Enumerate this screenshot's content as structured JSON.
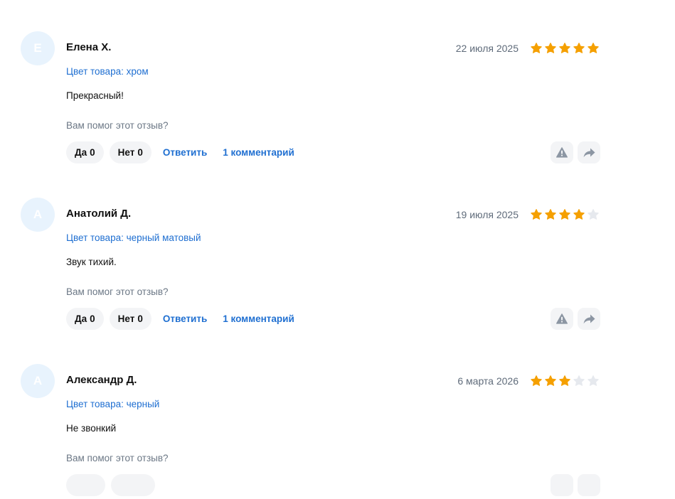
{
  "reviews": [
    {
      "avatar_letter": "Е",
      "author": "Елена Х.",
      "date": "22 июля 2025",
      "rating": 5,
      "variant": "Цвет товара: хром",
      "text": "Прекрасный!",
      "helpful_question": "Вам помог этот отзыв?",
      "yes_label": "Да",
      "yes_count": "0",
      "no_label": "Нет",
      "no_count": "0",
      "reply_label": "Ответить",
      "comments_label": "1 комментарий"
    },
    {
      "avatar_letter": "А",
      "author": "Анатолий Д.",
      "date": "19 июля 2025",
      "rating": 4,
      "variant": "Цвет товара: черный матовый",
      "text": "Звук тихий.",
      "helpful_question": "Вам помог этот отзыв?",
      "yes_label": "Да",
      "yes_count": "0",
      "no_label": "Нет",
      "no_count": "0",
      "reply_label": "Ответить",
      "comments_label": "1 комментарий"
    },
    {
      "avatar_letter": "А",
      "author": "Александр Д.",
      "date": "6 марта 2026",
      "rating": 3,
      "variant": "Цвет товара: черный",
      "text": "Не звонкий",
      "helpful_question": "Вам помог этот отзыв?",
      "yes_label": "",
      "yes_count": "",
      "no_label": "",
      "no_count": "",
      "reply_label": "",
      "comments_label": ""
    }
  ],
  "colors": {
    "star_filled": "#f5a000",
    "star_empty": "#e6e9ee",
    "link": "#1f6fd1",
    "avatar_bg": "#e8f3fd",
    "icon": "#8c96a3"
  },
  "icons": {
    "report": "warning-triangle-icon",
    "share": "share-arrow-icon",
    "star": "star-icon"
  }
}
